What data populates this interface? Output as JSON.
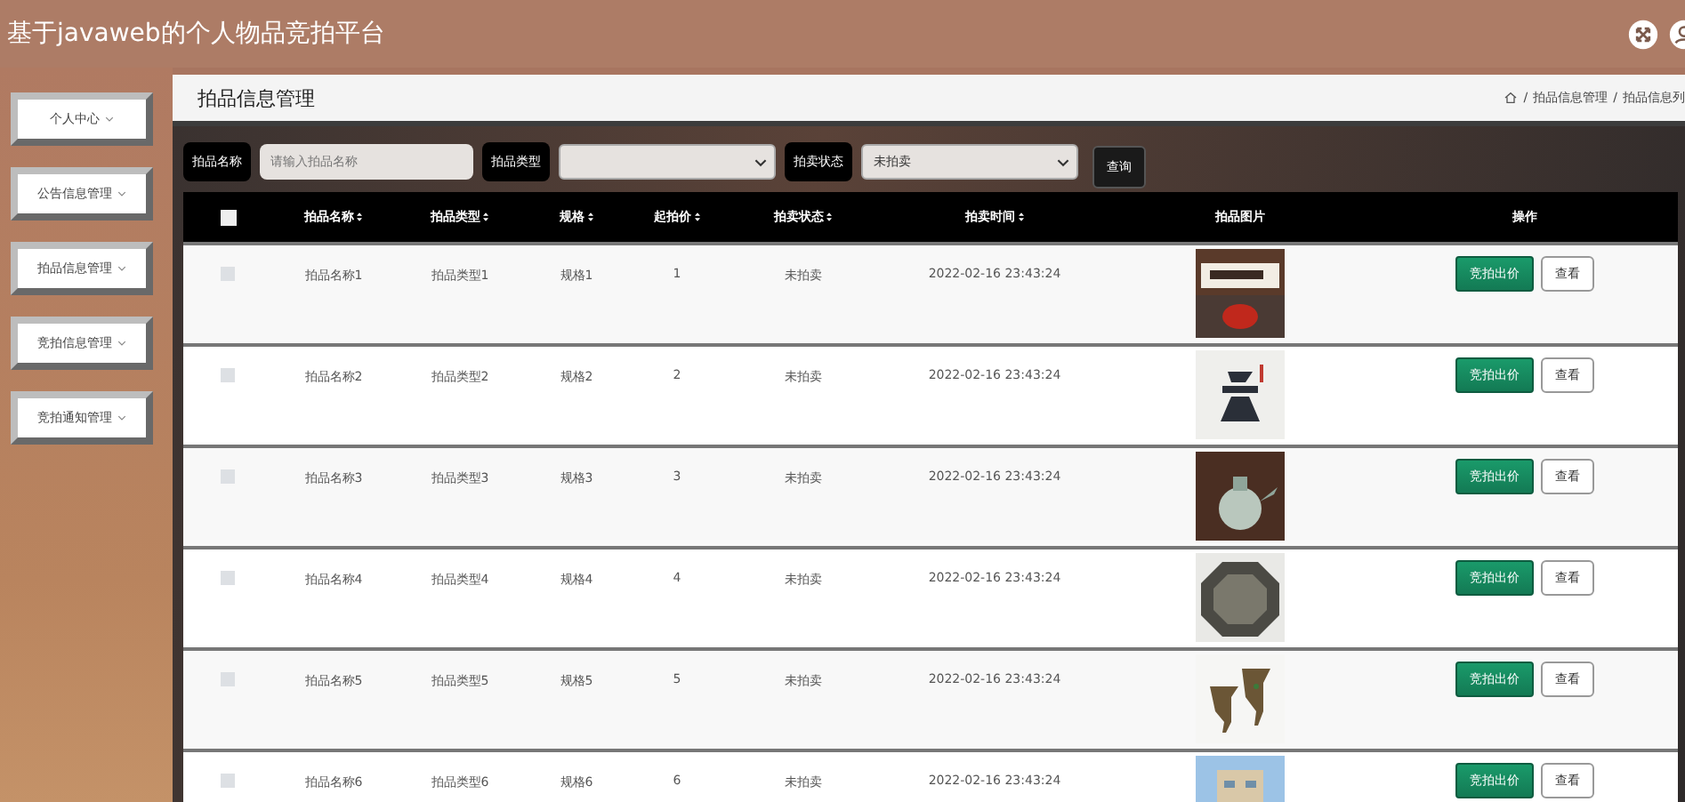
{
  "header": {
    "title": "基于javaweb的个人物品竞拍平台"
  },
  "sidebar": {
    "items": [
      {
        "label": "个人中心"
      },
      {
        "label": "公告信息管理"
      },
      {
        "label": "拍品信息管理"
      },
      {
        "label": "竞拍信息管理"
      },
      {
        "label": "竞拍通知管理"
      }
    ]
  },
  "page": {
    "title": "拍品信息管理",
    "breadcrumb": [
      "拍品信息管理",
      "拍品信息列"
    ],
    "breadcrumb_separator": "/"
  },
  "filters": [
    {
      "kind": "text",
      "label": "拍品名称",
      "placeholder": "请输入拍品名称"
    },
    {
      "kind": "select",
      "label": "拍品类型"
    },
    {
      "kind": "select",
      "label": "拍卖状态",
      "value": "未拍卖"
    }
  ],
  "search_button": "查询",
  "table": {
    "all_checked": false,
    "columns": [
      {
        "label": "拍品名称",
        "sortable": true
      },
      {
        "label": "拍品类型",
        "sortable": true
      },
      {
        "label": "规格",
        "sortable": true
      },
      {
        "label": "起拍价",
        "sortable": true
      },
      {
        "label": "拍卖状态",
        "sortable": true
      },
      {
        "label": "拍卖时间",
        "sortable": true
      },
      {
        "label": "拍品图片",
        "sortable": false
      },
      {
        "label": "操作",
        "sortable": false
      }
    ],
    "rows": [
      {
        "checked": false,
        "name": "拍品名称1",
        "type": "拍品类型1",
        "spec": "规格1",
        "price": "1",
        "status": "未拍卖",
        "time": "2022-02-16 23:43:24",
        "actions": [
          "竞拍出价",
          "查看"
        ]
      },
      {
        "checked": false,
        "name": "拍品名称2",
        "type": "拍品类型2",
        "spec": "规格2",
        "price": "2",
        "status": "未拍卖",
        "time": "2022-02-16 23:43:24",
        "actions": [
          "竞拍出价",
          "查看"
        ]
      },
      {
        "checked": false,
        "name": "拍品名称3",
        "type": "拍品类型3",
        "spec": "规格3",
        "price": "3",
        "status": "未拍卖",
        "time": "2022-02-16 23:43:24",
        "actions": [
          "竞拍出价",
          "查看"
        ]
      },
      {
        "checked": false,
        "name": "拍品名称4",
        "type": "拍品类型4",
        "spec": "规格4",
        "price": "4",
        "status": "未拍卖",
        "time": "2022-02-16 23:43:24",
        "actions": [
          "竞拍出价",
          "查看"
        ]
      },
      {
        "checked": false,
        "name": "拍品名称5",
        "type": "拍品类型5",
        "spec": "规格5",
        "price": "5",
        "status": "未拍卖",
        "time": "2022-02-16 23:43:24",
        "actions": [
          "竞拍出价",
          "查看"
        ]
      },
      {
        "checked": false,
        "name": "拍品名称6",
        "type": "拍品类型6",
        "spec": "规格6",
        "price": "6",
        "status": "未拍卖",
        "time": "2022-02-16 23:43:24",
        "actions": [
          "竞拍出价",
          "查看"
        ]
      }
    ]
  }
}
